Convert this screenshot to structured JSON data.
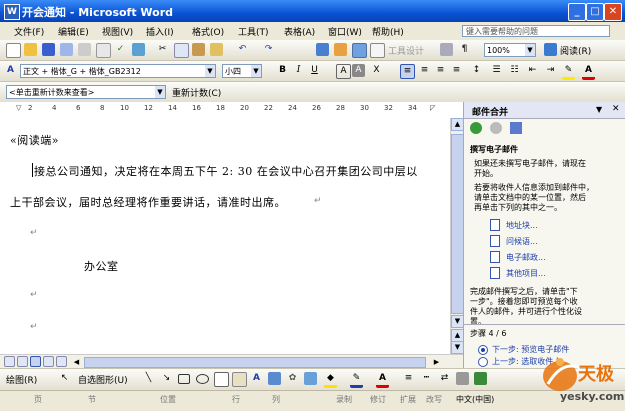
{
  "window": {
    "title": "开会通知 - Microsoft Word",
    "icon_letter": "W"
  },
  "menubar": {
    "items": [
      "文件(F)",
      "编辑(E)",
      "视图(V)",
      "插入(I)",
      "格式(O)",
      "工具(T)",
      "表格(A)",
      "窗口(W)",
      "帮助(H)"
    ],
    "help_placeholder": "键入需要帮助的问题"
  },
  "standard_toolbar": {
    "zoom": "100%",
    "read_label": "阅读(R)",
    "tool_design": "工具设计"
  },
  "format_toolbar": {
    "style": "正文 + 楷体_G + 楷体_GB2312",
    "font": "楷体_GB2312",
    "size": "小四"
  },
  "review_toolbar": {
    "markup": "<单击重新计数来查看>",
    "recount": "重新计数(C)"
  },
  "document": {
    "heading": "«阅读端»",
    "line1": "接总公司通知，决定将在本周五下午 2: 30 在会议中心召开集团公司中层以",
    "line2": "上干部会议，届时总经理将作重要讲话，请准时出席。",
    "signature": "办公室"
  },
  "taskpane": {
    "title": "邮件合并",
    "section": "撰写电子邮件",
    "p1": [
      "如果还未撰写电子邮件，请现在",
      "开始。"
    ],
    "p2": [
      "若要将收件人信息添加到邮件中，",
      "请单击文档中的某一位置，然后",
      "再单击下列的其中之一。"
    ],
    "links": [
      "地址块...",
      "问候语...",
      "电子邮政...",
      "其他项目..."
    ],
    "p3": [
      "完成邮件撰写之后，请单击\"下",
      "一步\"。接着您即可预览每个收",
      "件人的邮件，并可进行个性化设",
      "置。"
    ],
    "step": "步骤 4 / 6",
    "next": "下一步: 预览电子邮件",
    "prev": "上一步: 选取收件人"
  },
  "drawbar": {
    "draw": "绘图(R)",
    "autoshapes": "自选图形(U)"
  },
  "statusbar": {
    "page": "页",
    "section": "节",
    "position": "位置",
    "line": "行",
    "col": "列",
    "rec": "录制",
    "trk": "修订",
    "ext": "扩展",
    "ovr": "改写",
    "lang": "中文(中国)"
  },
  "watermark": {
    "brand": "天极",
    "domain": "yesky.com"
  },
  "colors": {
    "title_blue": "#0a53d6",
    "link_blue": "#1f3ea8",
    "watermark_orange": "#e8730c"
  }
}
